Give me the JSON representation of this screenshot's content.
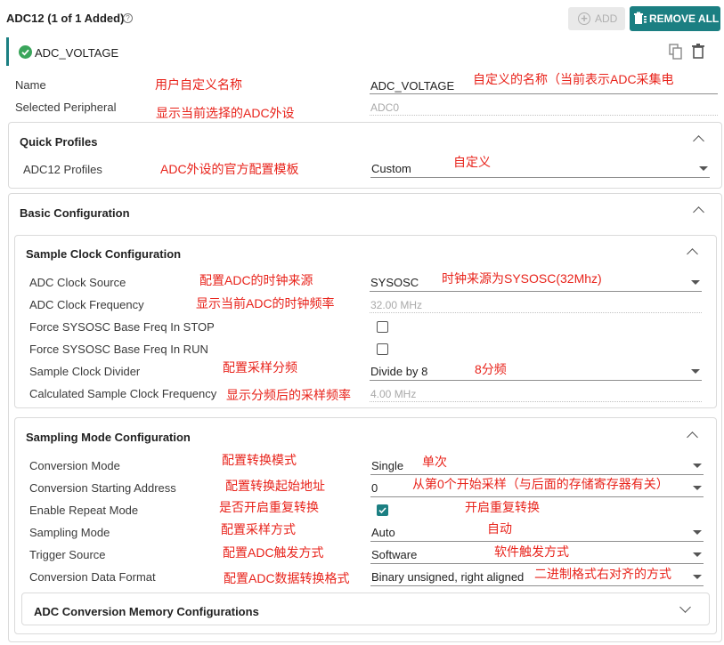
{
  "header": {
    "title": "ADC12 (1 of 1 Added)",
    "add_label": "ADD",
    "remove_all_label": "REMOVE ALL"
  },
  "instance": {
    "name": "ADC_VOLTAGE"
  },
  "fields": {
    "name_label": "Name",
    "name_value": "ADC_VOLTAGE",
    "peripheral_label": "Selected Peripheral",
    "peripheral_value": "ADC0"
  },
  "quick_profiles": {
    "title": "Quick Profiles",
    "profiles_label": "ADC12 Profiles",
    "profiles_value": "Custom"
  },
  "basic": {
    "title": "Basic Configuration"
  },
  "sample_clock": {
    "title": "Sample Clock Configuration",
    "clock_source_label": "ADC Clock Source",
    "clock_source_value": "SYSOSC",
    "clock_freq_label": "ADC Clock Frequency",
    "clock_freq_value": "32.00 MHz",
    "force_stop_label": "Force SYSOSC Base Freq In STOP",
    "force_run_label": "Force SYSOSC Base Freq In RUN",
    "divider_label": "Sample Clock Divider",
    "divider_value": "Divide by 8",
    "calc_freq_label": "Calculated Sample Clock Frequency",
    "calc_freq_value": "4.00 MHz",
    "force_stop_checked": false,
    "force_run_checked": false
  },
  "sampling_mode": {
    "title": "Sampling Mode Configuration",
    "conversion_mode_label": "Conversion Mode",
    "conversion_mode_value": "Single",
    "start_addr_label": "Conversion Starting Address",
    "start_addr_value": "0",
    "repeat_label": "Enable Repeat Mode",
    "repeat_checked": true,
    "sampling_label": "Sampling Mode",
    "sampling_value": "Auto",
    "trigger_label": "Trigger Source",
    "trigger_value": "Software",
    "format_label": "Conversion Data Format",
    "format_value": "Binary unsigned, right aligned"
  },
  "memory": {
    "title": "ADC Conversion Memory Configurations"
  },
  "annotations": {
    "name": "用户自定义名称",
    "name_value": "自定义的名称（当前表示ADC采集电",
    "peripheral": "显示当前选择的ADC外设",
    "profiles": "ADC外设的官方配置模板",
    "profiles_value": "自定义",
    "clock_source": "配置ADC的时钟来源",
    "clock_source_value": "时钟来源为SYSOSC(32Mhz)",
    "clock_freq": "显示当前ADC的时钟频率",
    "divider": "配置采样分频",
    "divider_value": "8分频",
    "calc_freq": "显示分频后的采样频率",
    "conversion_mode": "配置转换模式",
    "conversion_mode_value": "单次",
    "start_addr": "配置转换起始地址",
    "start_addr_value": "从第0个开始采样（与后面的存储寄存器有关）",
    "repeat": "是否开启重复转换",
    "repeat_value": "开启重复转换",
    "sampling": "配置采样方式",
    "sampling_value": "自动",
    "trigger": "配置ADC触发方式",
    "trigger_value": "软件触发方式",
    "format": "配置ADC数据转换格式",
    "format_value": "二进制格式右对齐的方式"
  },
  "colors": {
    "accent": "#1b7f82",
    "annotation": "#e8231b",
    "success": "#3aa55b"
  }
}
